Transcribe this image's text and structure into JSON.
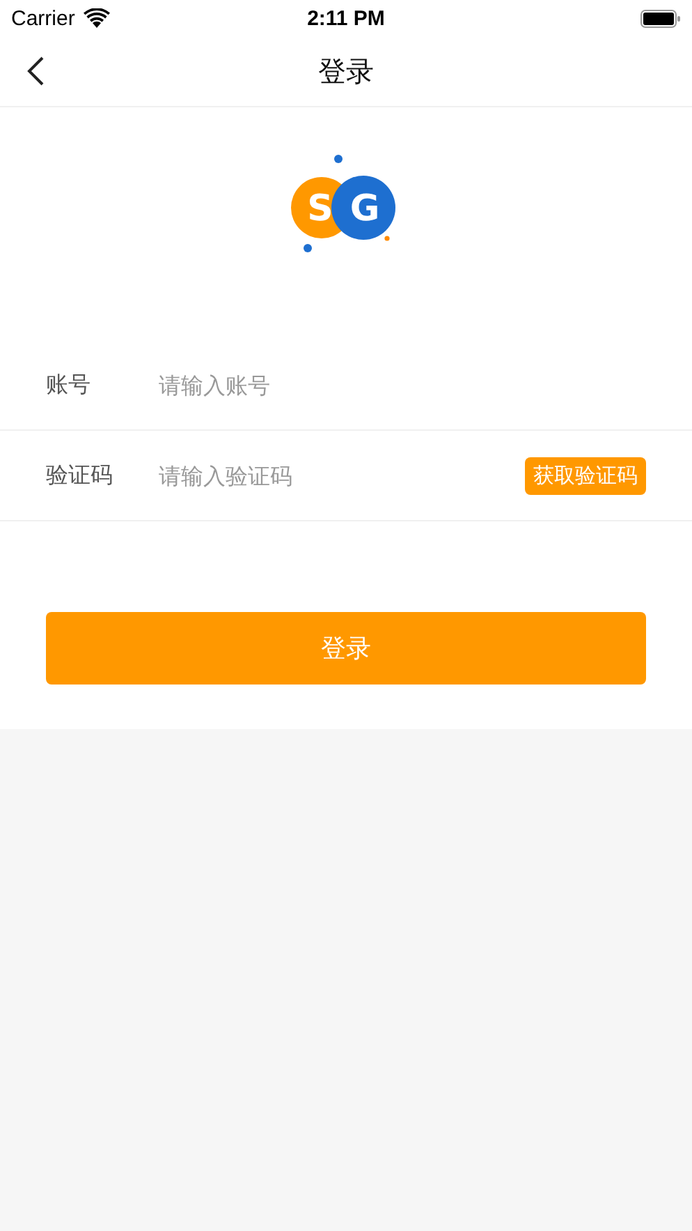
{
  "status_bar": {
    "carrier": "Carrier",
    "time": "2:11 PM"
  },
  "nav": {
    "title": "登录"
  },
  "logo": {
    "letters": [
      "S",
      "G"
    ]
  },
  "fields": [
    {
      "kind": "text",
      "label": "账号",
      "placeholder": "请输入账号"
    },
    {
      "kind": "code",
      "label": "验证码",
      "placeholder": "请输入验证码",
      "action": "获取验证码"
    }
  ],
  "submit": "登录"
}
